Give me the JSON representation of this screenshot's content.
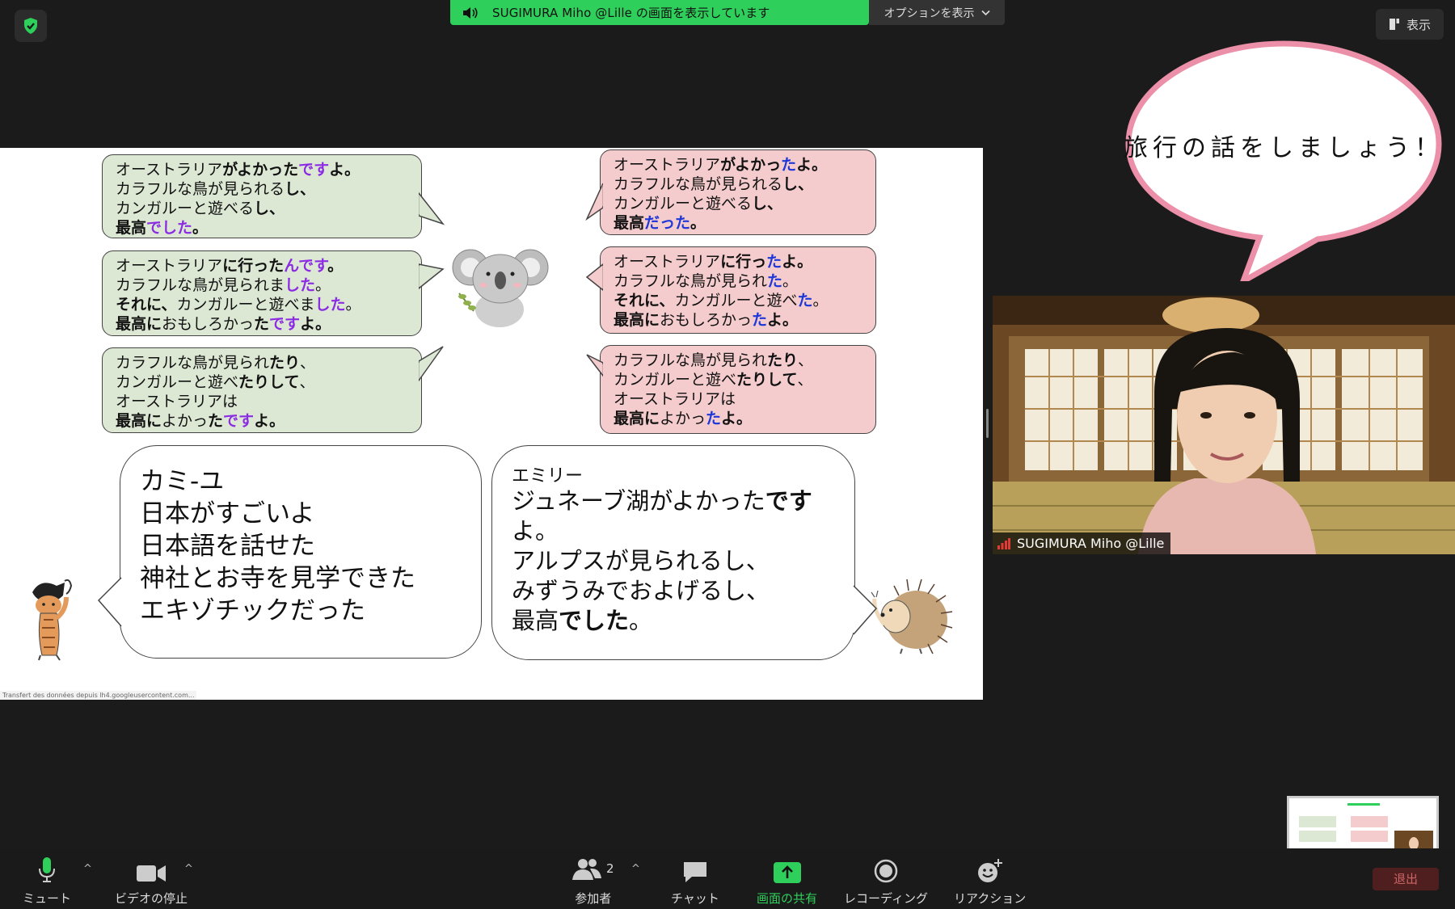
{
  "banner": {
    "sharing_text": "SUGIMURA Miho @Lille の画面を表示しています",
    "options_label": "オプションを表示",
    "view_label": "表示"
  },
  "slide": {
    "left_bubbles": [
      {
        "lines": [
          [
            {
              "t": "オーストラリア",
              "s": ""
            },
            {
              "t": "がよかった",
              "s": "b"
            },
            {
              "t": "です",
              "s": "pu"
            },
            {
              "t": "よ。",
              "s": "b"
            }
          ],
          [
            {
              "t": "カラフルな鳥が見られる",
              "s": ""
            },
            {
              "t": "し、",
              "s": "b"
            }
          ],
          [
            {
              "t": "カンガルーと遊べる",
              "s": ""
            },
            {
              "t": "し、",
              "s": "b"
            }
          ],
          [
            {
              "t": "最高",
              "s": "b"
            },
            {
              "t": "でした",
              "s": "pu"
            },
            {
              "t": "。",
              "s": "b"
            }
          ]
        ]
      },
      {
        "lines": [
          [
            {
              "t": "オーストラリア",
              "s": ""
            },
            {
              "t": "に行った",
              "s": "b"
            },
            {
              "t": "んです",
              "s": "pu"
            },
            {
              "t": "。",
              "s": "b"
            }
          ],
          [
            {
              "t": "カラフルな鳥が見られま",
              "s": ""
            },
            {
              "t": "した",
              "s": "pu"
            },
            {
              "t": "。",
              "s": ""
            }
          ],
          [
            {
              "t": "それに、",
              "s": "b"
            },
            {
              "t": "カンガルーと遊べま",
              "s": ""
            },
            {
              "t": "した",
              "s": "pu"
            },
            {
              "t": "。",
              "s": ""
            }
          ],
          [
            {
              "t": "最高に",
              "s": "b"
            },
            {
              "t": "おもしろかっ",
              "s": ""
            },
            {
              "t": "た",
              "s": "b"
            },
            {
              "t": "です",
              "s": "pu"
            },
            {
              "t": "よ。",
              "s": "b"
            }
          ]
        ]
      },
      {
        "lines": [
          [
            {
              "t": "カラフルな鳥が見られ",
              "s": ""
            },
            {
              "t": "たり",
              "s": "b"
            },
            {
              "t": "、",
              "s": ""
            }
          ],
          [
            {
              "t": "カンガルーと遊べ",
              "s": ""
            },
            {
              "t": "たりして",
              "s": "b"
            },
            {
              "t": "、",
              "s": ""
            }
          ],
          [
            {
              "t": "オーストラリアは",
              "s": ""
            }
          ],
          [
            {
              "t": "最高に",
              "s": "b"
            },
            {
              "t": "よかっ",
              "s": ""
            },
            {
              "t": "た",
              "s": "b"
            },
            {
              "t": "です",
              "s": "pu"
            },
            {
              "t": "よ。",
              "s": "b"
            }
          ]
        ]
      }
    ],
    "right_bubbles": [
      {
        "lines": [
          [
            {
              "t": "オーストラリア",
              "s": ""
            },
            {
              "t": "がよかっ",
              "s": "b"
            },
            {
              "t": "た",
              "s": "bl"
            },
            {
              "t": "よ。",
              "s": "b"
            }
          ],
          [
            {
              "t": "カラフルな鳥が見られる",
              "s": ""
            },
            {
              "t": "し、",
              "s": "b"
            }
          ],
          [
            {
              "t": "カンガルーと遊べる",
              "s": ""
            },
            {
              "t": "し、",
              "s": "b"
            }
          ],
          [
            {
              "t": "最高",
              "s": "b"
            },
            {
              "t": "だった",
              "s": "bl"
            },
            {
              "t": "。",
              "s": "b"
            }
          ]
        ]
      },
      {
        "lines": [
          [
            {
              "t": "オーストラリア",
              "s": ""
            },
            {
              "t": "に行っ",
              "s": "b"
            },
            {
              "t": "た",
              "s": "bl"
            },
            {
              "t": "よ。",
              "s": "b"
            }
          ],
          [
            {
              "t": "カラフルな鳥が見られ",
              "s": ""
            },
            {
              "t": "た",
              "s": "bl"
            },
            {
              "t": "。",
              "s": ""
            }
          ],
          [
            {
              "t": "それに、",
              "s": "b"
            },
            {
              "t": "カンガルーと遊べ",
              "s": ""
            },
            {
              "t": "た",
              "s": "bl"
            },
            {
              "t": "。",
              "s": ""
            }
          ],
          [
            {
              "t": "最高に",
              "s": "b"
            },
            {
              "t": "おもしろかっ",
              "s": ""
            },
            {
              "t": "た",
              "s": "bl"
            },
            {
              "t": "よ。",
              "s": "b"
            }
          ]
        ]
      },
      {
        "lines": [
          [
            {
              "t": "カラフルな鳥が見られ",
              "s": ""
            },
            {
              "t": "たり",
              "s": "b"
            },
            {
              "t": "、",
              "s": ""
            }
          ],
          [
            {
              "t": "カンガルーと遊べ",
              "s": ""
            },
            {
              "t": "たりして",
              "s": "b"
            },
            {
              "t": "、",
              "s": ""
            }
          ],
          [
            {
              "t": "オーストラリアは",
              "s": ""
            }
          ],
          [
            {
              "t": "最高に",
              "s": "b"
            },
            {
              "t": "よかっ",
              "s": ""
            },
            {
              "t": "た",
              "s": "bl"
            },
            {
              "t": "よ。",
              "s": "b"
            }
          ]
        ]
      }
    ],
    "camille": {
      "lines": [
        "カミ-ユ",
        "日本がすごいよ",
        "日本語を話せた",
        "神社とお寺を見学できた",
        "エキゾチックだった"
      ]
    },
    "emily": {
      "name": "エミリー",
      "lines": [
        [
          {
            "t": "ジュネーブ湖がよかった",
            "s": ""
          },
          {
            "t": "です",
            "s": "b"
          }
        ],
        [
          {
            "t": "よ。",
            "s": ""
          }
        ],
        [
          {
            "t": "アルプスが見られるし、",
            "s": ""
          }
        ],
        [
          {
            "t": "みずうみでおよげるし、",
            "s": ""
          }
        ],
        [
          {
            "t": "最高",
            "s": ""
          },
          {
            "t": "でした",
            "s": "b"
          },
          {
            "t": "。",
            "s": ""
          }
        ]
      ]
    },
    "status_text": "Transfert des données depuis lh4.googleusercontent.com..."
  },
  "video": {
    "name": "SUGIMURA Miho @Lille",
    "speech": "旅行の話をしましょう！"
  },
  "toolbar": {
    "mute": "ミュート",
    "video": "ビデオの停止",
    "participants": "参加者",
    "participant_count": "2",
    "chat": "チャット",
    "share": "画面の共有",
    "record": "レコーディング",
    "reactions": "リアクション",
    "leave": "退出"
  },
  "colors": {
    "share_green": "#2fcf5b",
    "purple": "#8b2be2",
    "blue": "#1e38d8",
    "green_bubble": "#dce8d4",
    "pink_bubble": "#f5cccd"
  }
}
